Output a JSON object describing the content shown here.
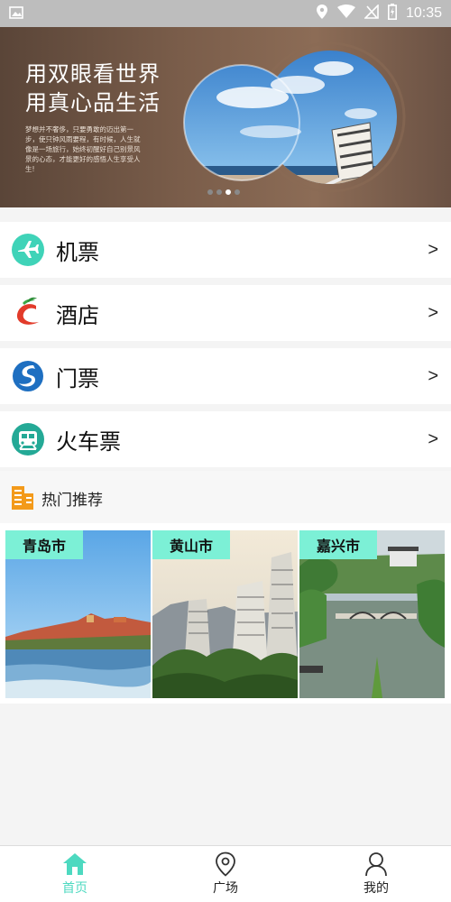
{
  "status_bar": {
    "time": "10:35"
  },
  "banner": {
    "title_line1": "用双眼看世界",
    "title_line2": "用真心品生活",
    "description": "梦想并不奢侈，只要勇敢的迈出第一步，使只钟风雨要程，有时候，人生就像是一场旅行，始终初醒好自己别景风景的心态，才能更好的感悟人生享受人生!",
    "dots": 4,
    "active_dot": 2
  },
  "menu": {
    "items": [
      {
        "label": "机票",
        "icon": "plane-icon",
        "arrow": ">"
      },
      {
        "label": "酒店",
        "icon": "hotel-icon",
        "arrow": ">"
      },
      {
        "label": "门票",
        "icon": "ticket-icon",
        "arrow": ">"
      },
      {
        "label": "火车票",
        "icon": "train-icon",
        "arrow": ">"
      }
    ]
  },
  "hot": {
    "title": "热门推荐",
    "cities": [
      {
        "name": "青岛市"
      },
      {
        "name": "黄山市"
      },
      {
        "name": "嘉兴市"
      }
    ]
  },
  "bottom_nav": {
    "items": [
      {
        "label": "首页",
        "icon": "home-icon",
        "active": true
      },
      {
        "label": "广场",
        "icon": "location-pin-icon",
        "active": false
      },
      {
        "label": "我的",
        "icon": "user-icon",
        "active": false
      }
    ]
  },
  "colors": {
    "accent": "#4dd9c0",
    "tag": "#7cf0d6",
    "status_bar": "#bdbdbd"
  }
}
